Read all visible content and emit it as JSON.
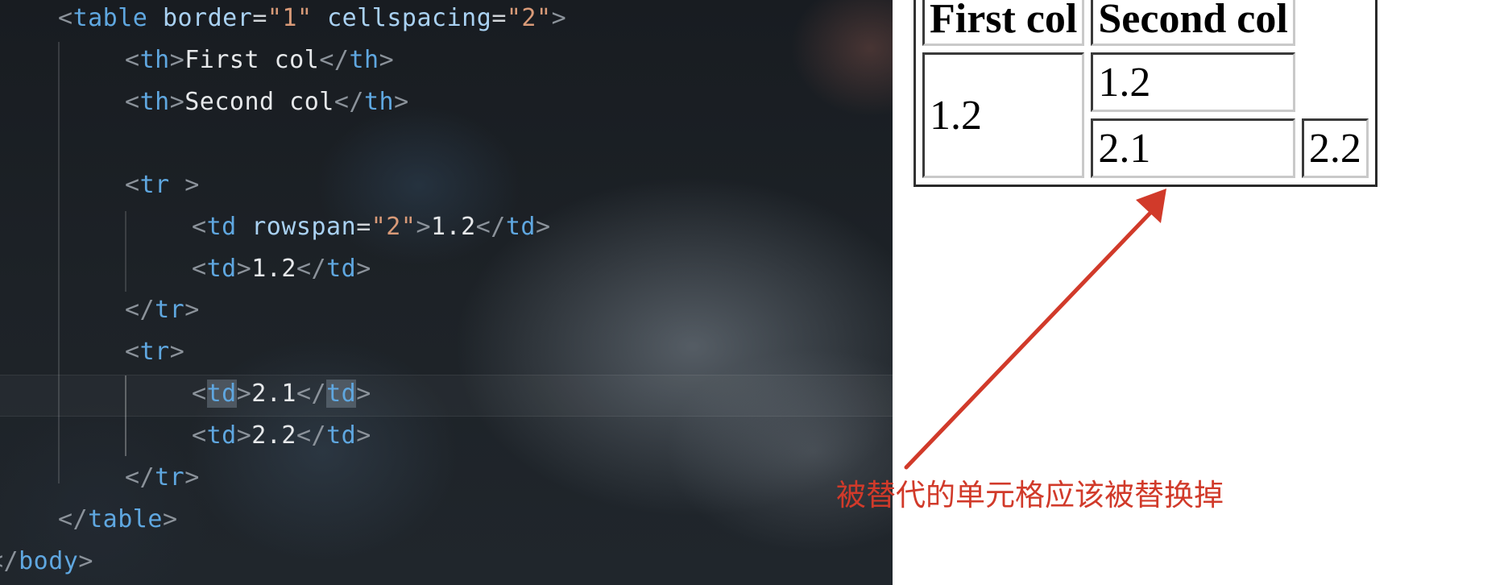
{
  "editor": {
    "lines": [
      [
        [
          "punct",
          "<"
        ],
        [
          "tag",
          "table"
        ],
        [
          "text",
          " "
        ],
        [
          "attr",
          "border"
        ],
        [
          "eq",
          "="
        ],
        [
          "str",
          "\"1\""
        ],
        [
          "text",
          " "
        ],
        [
          "attr",
          "cellspacing"
        ],
        [
          "eq",
          "="
        ],
        [
          "str",
          "\"2\""
        ],
        [
          "punct",
          ">"
        ]
      ],
      [
        [
          "punct",
          "<"
        ],
        [
          "tag",
          "th"
        ],
        [
          "punct",
          ">"
        ],
        [
          "text",
          "First col"
        ],
        [
          "punct",
          "</"
        ],
        [
          "tag",
          "th"
        ],
        [
          "punct",
          ">"
        ]
      ],
      [
        [
          "punct",
          "<"
        ],
        [
          "tag",
          "th"
        ],
        [
          "punct",
          ">"
        ],
        [
          "text",
          "Second col"
        ],
        [
          "punct",
          "</"
        ],
        [
          "tag",
          "th"
        ],
        [
          "punct",
          ">"
        ]
      ],
      [],
      [
        [
          "punct",
          "<"
        ],
        [
          "tag",
          "tr"
        ],
        [
          "text",
          " "
        ],
        [
          "punct",
          ">"
        ]
      ],
      [
        [
          "punct",
          "<"
        ],
        [
          "tag",
          "td"
        ],
        [
          "text",
          " "
        ],
        [
          "attr",
          "rowspan"
        ],
        [
          "eq",
          "="
        ],
        [
          "str",
          "\"2\""
        ],
        [
          "punct",
          ">"
        ],
        [
          "text",
          "1.2"
        ],
        [
          "punct",
          "</"
        ],
        [
          "tag",
          "td"
        ],
        [
          "punct",
          ">"
        ]
      ],
      [
        [
          "punct",
          "<"
        ],
        [
          "tag",
          "td"
        ],
        [
          "punct",
          ">"
        ],
        [
          "text",
          "1.2"
        ],
        [
          "punct",
          "</"
        ],
        [
          "tag",
          "td"
        ],
        [
          "punct",
          ">"
        ]
      ],
      [
        [
          "punct",
          "</"
        ],
        [
          "tag",
          "tr"
        ],
        [
          "punct",
          ">"
        ]
      ],
      [
        [
          "punct",
          "<"
        ],
        [
          "tag",
          "tr"
        ],
        [
          "punct",
          ">"
        ]
      ],
      [
        [
          "punct",
          "<"
        ],
        [
          "tag",
          "td",
          "hl"
        ],
        [
          "punct",
          ">"
        ],
        [
          "text",
          "2.1"
        ],
        [
          "punct",
          "</"
        ],
        [
          "tag",
          "td",
          "hl"
        ],
        [
          "punct",
          ">"
        ]
      ],
      [
        [
          "punct",
          "<"
        ],
        [
          "tag",
          "td"
        ],
        [
          "punct",
          ">"
        ],
        [
          "text",
          "2.2"
        ],
        [
          "punct",
          "</"
        ],
        [
          "tag",
          "td"
        ],
        [
          "punct",
          ">"
        ]
      ],
      [
        [
          "punct",
          "</"
        ],
        [
          "tag",
          "tr"
        ],
        [
          "punct",
          ">"
        ]
      ],
      [
        [
          "punct",
          "</"
        ],
        [
          "tag",
          "table"
        ],
        [
          "punct",
          ">"
        ]
      ],
      [
        [
          "punct",
          "</"
        ],
        [
          "tag",
          "body"
        ],
        [
          "punct",
          ">"
        ]
      ]
    ]
  },
  "preview": {
    "headers": [
      "First col",
      "Second col"
    ],
    "rows": [
      [
        "1.2",
        "1.2"
      ],
      [
        "2.1",
        "2.2"
      ]
    ]
  },
  "annotation": {
    "text": "被替代的单元格应该被替换掉",
    "color": "#d13a2a"
  }
}
